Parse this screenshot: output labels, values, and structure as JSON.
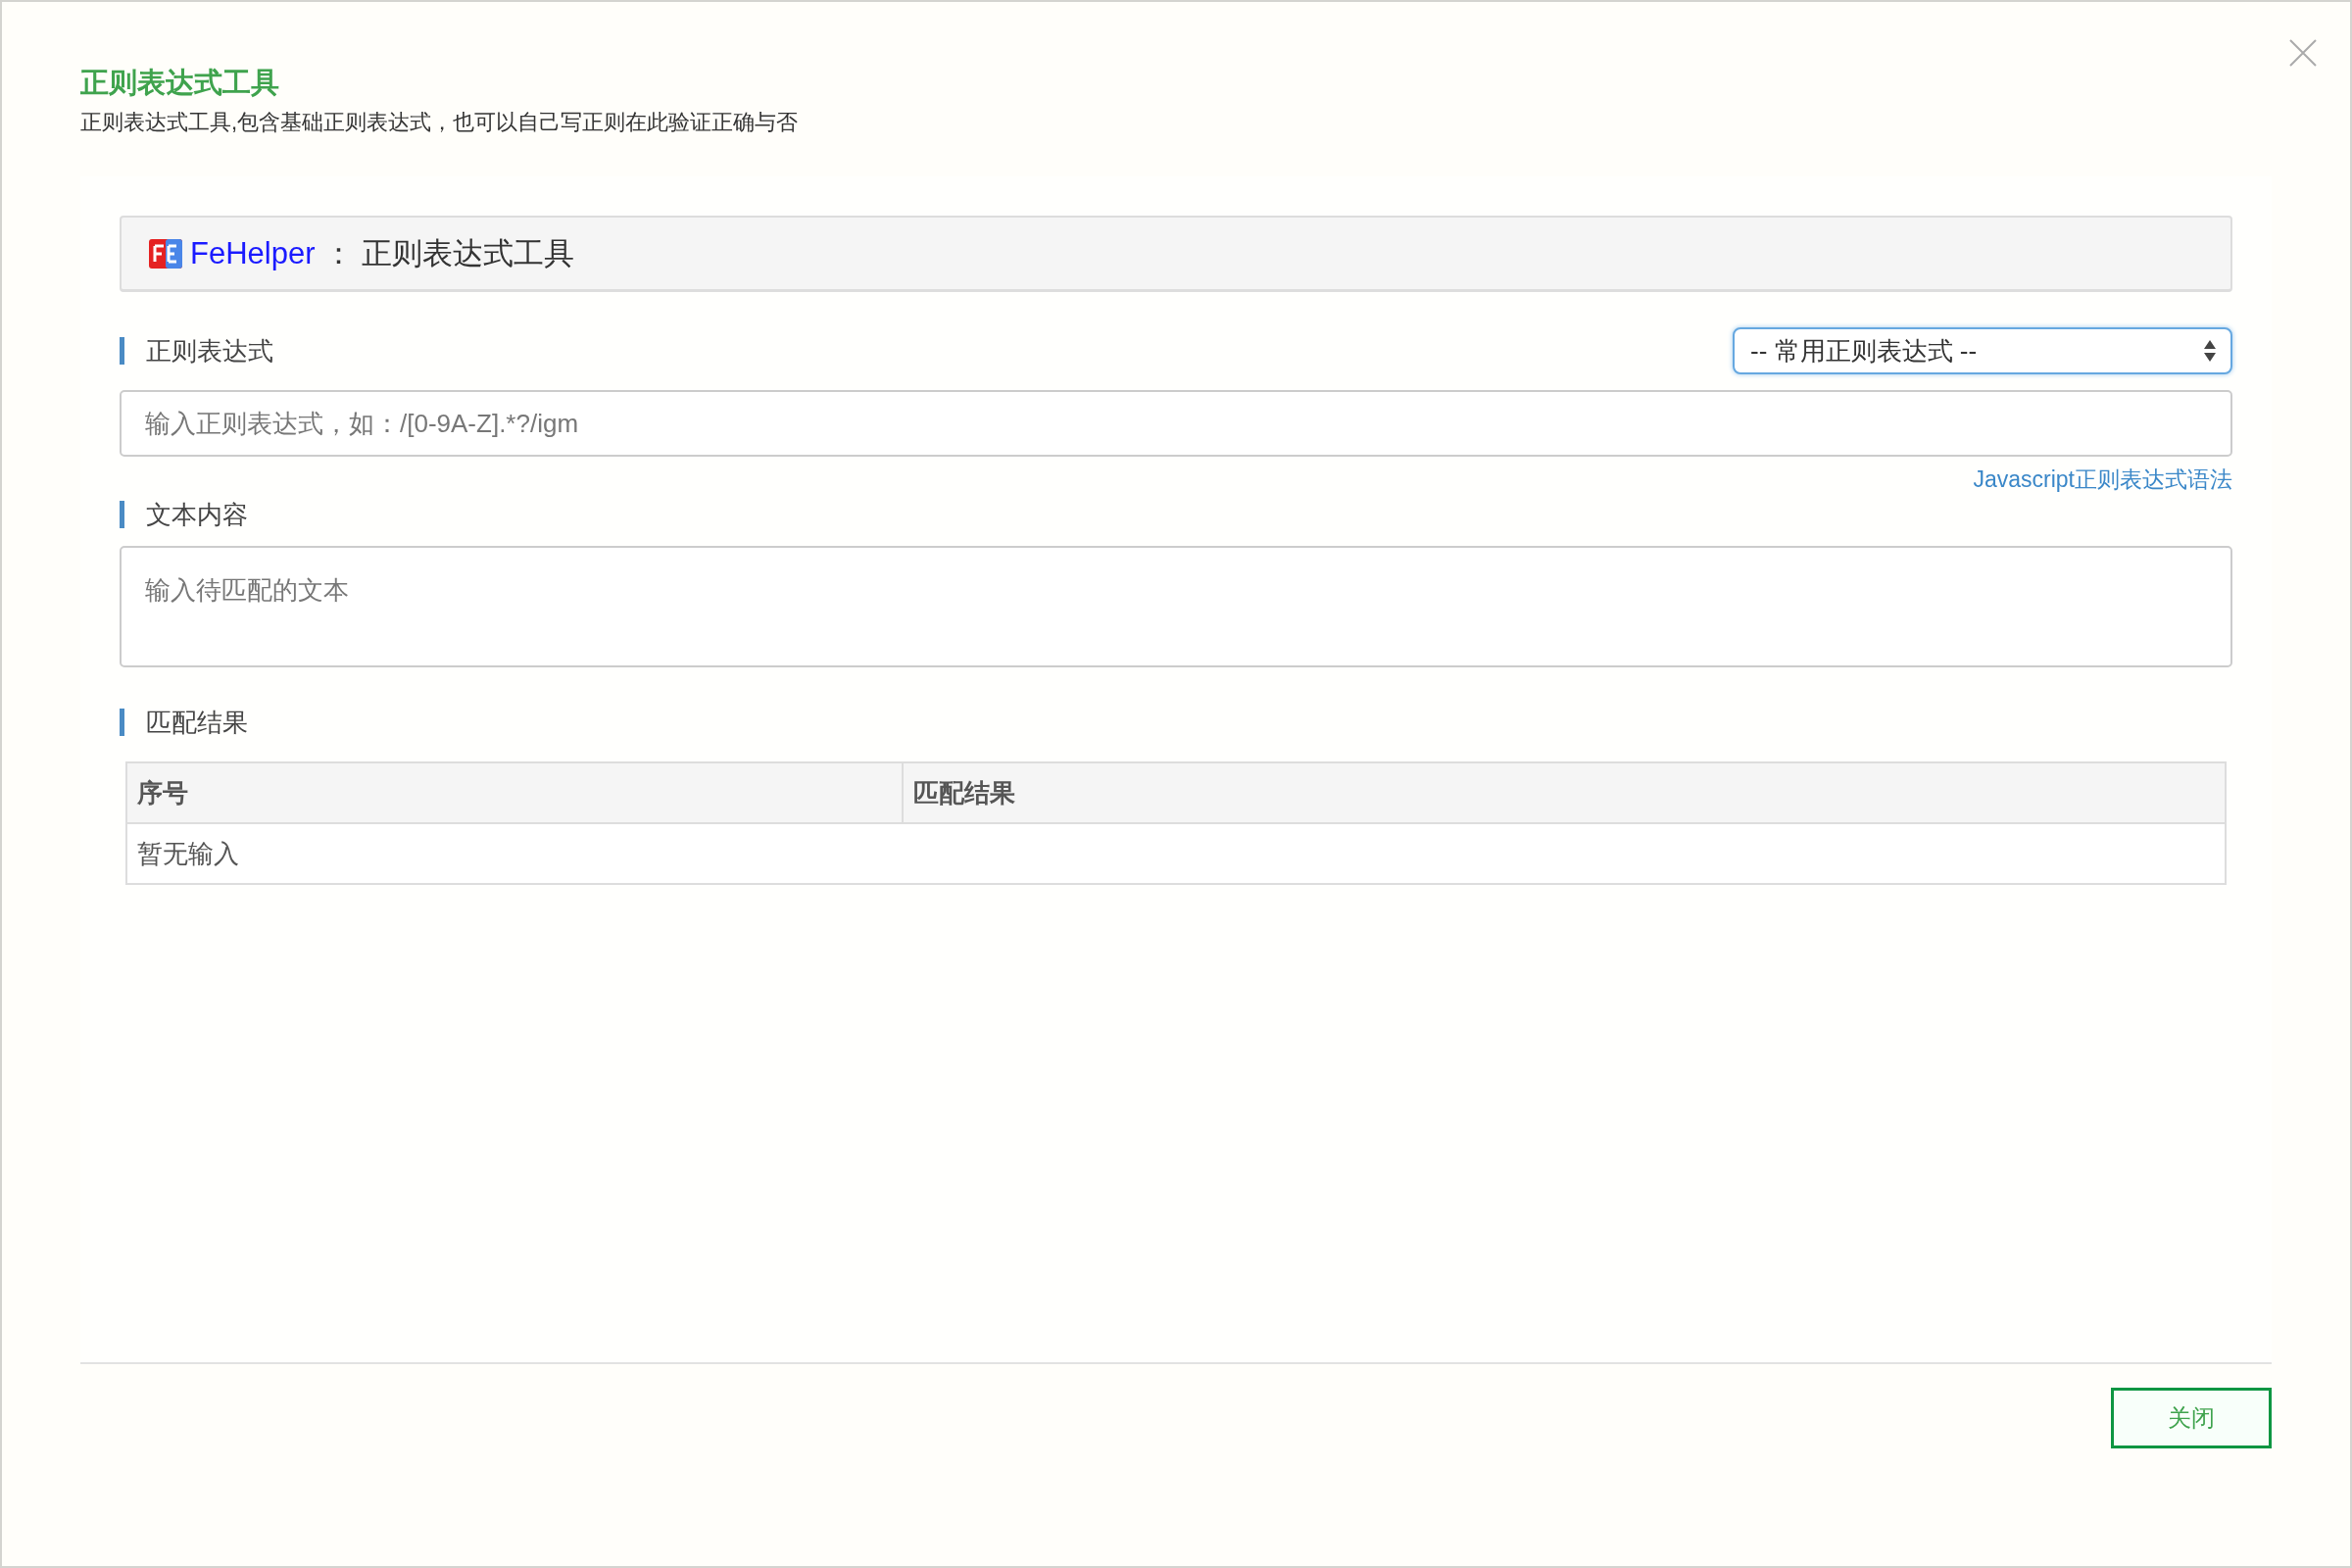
{
  "dialog": {
    "title": "正则表达式工具",
    "subtitle": "正则表达式工具,包含基础正则表达式，也可以自己写正则在此验证正确与否"
  },
  "header": {
    "brand": "FeHelper",
    "separator": "：",
    "title": "正则表达式工具"
  },
  "regex_section": {
    "label": "正则表达式",
    "preset_select": "-- 常用正则表达式 --",
    "input": {
      "placeholder": "输入正则表达式，如：/[0-9A-Z].*?/igm"
    },
    "help_link": "Javascript正则表达式语法"
  },
  "text_section": {
    "label": "文本内容",
    "textarea": {
      "placeholder": "输入待匹配的文本"
    }
  },
  "result_section": {
    "label": "匹配结果",
    "columns": [
      "序号",
      "匹配结果"
    ],
    "empty_message": "暂无输入"
  },
  "buttons": [
    "关闭"
  ]
}
